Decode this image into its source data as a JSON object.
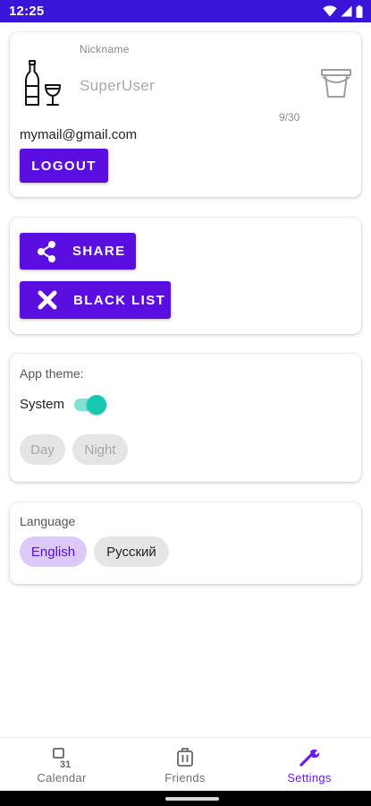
{
  "status_bar": {
    "time": "12:25",
    "icons": [
      "wifi-icon",
      "signal-icon",
      "battery-icon"
    ]
  },
  "profile": {
    "avatar_icon": "wine-bottle-glass-icon",
    "nickname_label": "Nickname",
    "nickname_value": "SuperUser",
    "nickname_counter": "9/30",
    "action_icon": "bucket-icon",
    "email": "mymail@gmail.com",
    "logout_label": "LOGOUT"
  },
  "actions": {
    "share_label": "SHARE",
    "share_icon": "share-icon",
    "blacklist_label": "BLACK LIST",
    "blacklist_icon": "close-icon"
  },
  "theme": {
    "title": "App theme:",
    "system_label": "System",
    "system_enabled": true,
    "options": [
      "Day",
      "Night"
    ]
  },
  "language": {
    "title": "Language",
    "options": [
      "English",
      "Русский"
    ],
    "selected": "English"
  },
  "bottom_nav": {
    "items": [
      {
        "label": "Calendar",
        "icon": "calendar-icon",
        "active": false
      },
      {
        "label": "Friends",
        "icon": "friends-icon",
        "active": false
      },
      {
        "label": "Settings",
        "icon": "wrench-icon",
        "active": true
      }
    ]
  },
  "colors": {
    "status_bar": "#3a14d9",
    "primary": "#5a0fe0",
    "switch_accent": "#14c9b0",
    "selected_chip": "#dcc8f9",
    "active_nav": "#6a1be8"
  }
}
